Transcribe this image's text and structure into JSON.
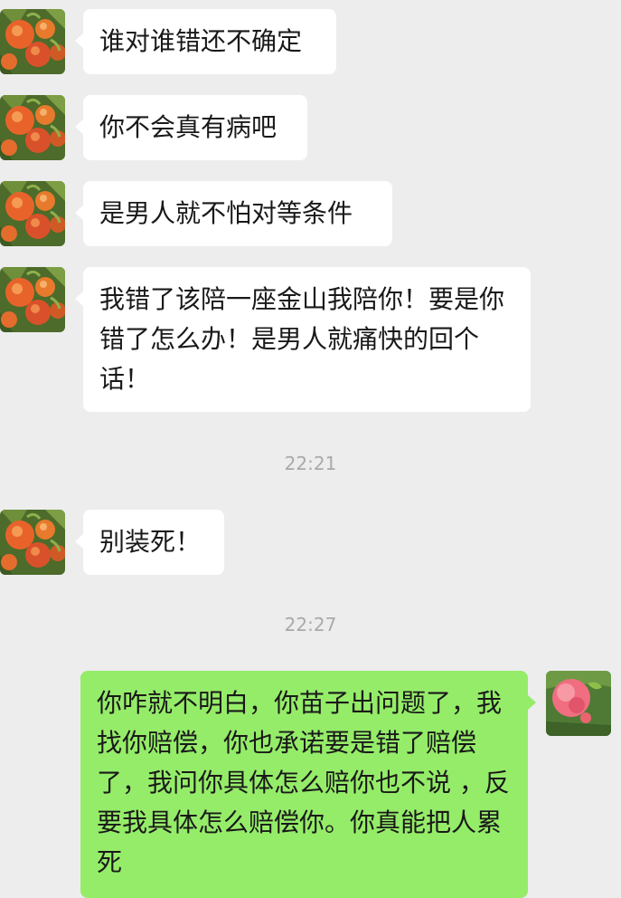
{
  "messages": [
    {
      "sender": "peer",
      "text": "谁对谁错还不确定"
    },
    {
      "sender": "peer",
      "text": "你不会真有病吧"
    },
    {
      "sender": "peer",
      "text": "是男人就不怕对等条件"
    },
    {
      "sender": "peer",
      "text": "我错了该陪一座金山我陪你！要是你错了怎么办！是男人就痛快的回个话！"
    },
    {
      "sender": "peer",
      "text": "别装死！"
    },
    {
      "sender": "self",
      "text": "你咋就不明白，你苗子出问题了，我找你赔偿，你也承诺要是错了赔偿了，我问你具体怎么赔你也不说 ，反要我具体怎么赔偿你。你真能把人累死"
    }
  ],
  "timestamps": [
    "22:21",
    "22:27"
  ],
  "avatars": {
    "peer": {
      "icon": "peach-tree-icon"
    },
    "self": {
      "icon": "peach-icon"
    }
  },
  "colors": {
    "background": "#ededed",
    "incoming_bubble": "#ffffff",
    "outgoing_bubble": "#95ec69",
    "timestamp_text": "#a9a9a9"
  }
}
